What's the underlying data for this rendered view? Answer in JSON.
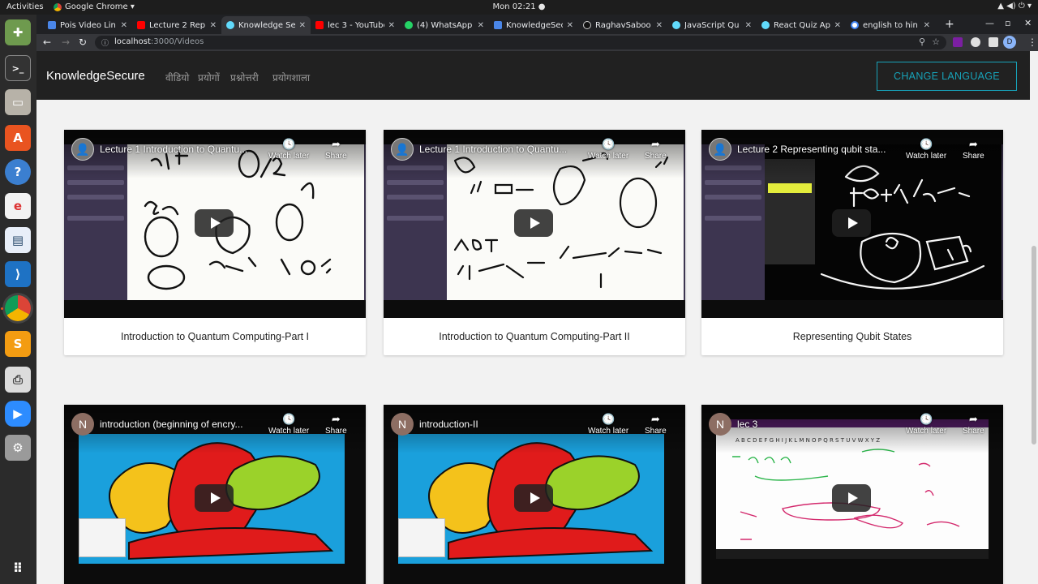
{
  "system": {
    "activities_label": "Activities",
    "app_name": "Google Chrome ▾",
    "clock": "Mon 02:21 ●",
    "tray": "▲ ◀) ⏻ ▾"
  },
  "browser": {
    "tabs": [
      {
        "title": "Pois Video Lin",
        "fav_color": "#4a86e8"
      },
      {
        "title": "Lecture 2 Repr",
        "fav_color": "#ff0000"
      },
      {
        "title": "Knowledge Se",
        "fav_color": "#61dafb",
        "active": true
      },
      {
        "title": "lec 3 - YouTube",
        "fav_color": "#ff0000"
      },
      {
        "title": "(4) WhatsApp",
        "fav_color": "#25d366"
      },
      {
        "title": "KnowledgeSec",
        "fav_color": "#4a86e8"
      },
      {
        "title": "RaghavSaboo",
        "fav_color": "#ffffff"
      },
      {
        "title": "JavaScript Qu",
        "fav_color": "#61dafb"
      },
      {
        "title": "React Quiz Ap",
        "fav_color": "#61dafb"
      },
      {
        "title": "english to hin",
        "fav_color": "#4285f4"
      }
    ],
    "url_host": "localhost",
    "url_path": ":3000/Videos",
    "profile_initial": "D"
  },
  "app": {
    "brand": "KnowledgeSecure",
    "nav": [
      "वीडियो",
      "प्रयोगों",
      "प्रश्नोत्तरी",
      "प्रयोगशाला"
    ],
    "change_language": "CHANGE LANGUAGE"
  },
  "youtube": {
    "watch_later": "Watch later",
    "share": "Share"
  },
  "videos": [
    {
      "title": "Introduction to Quantum Computing-Part I",
      "yt_title": "Lecture 1 Introduction to Quantu...",
      "style": "whiteboard"
    },
    {
      "title": "Introduction to Quantum Computing-Part II",
      "yt_title": "Lecture 1 Introduction to Quantu...",
      "style": "whiteboard"
    },
    {
      "title": "Representing Qubit States",
      "yt_title": "Lecture 2 Representing qubit sta...",
      "style": "blackboard"
    },
    {
      "title": "",
      "yt_title": "introduction (beginning of encry...",
      "avatar": "N",
      "style": "cipher"
    },
    {
      "title": "",
      "yt_title": "introduction-II",
      "avatar": "N",
      "style": "cipher"
    },
    {
      "title": "",
      "yt_title": "lec 3",
      "avatar": "N",
      "style": "notes"
    }
  ]
}
